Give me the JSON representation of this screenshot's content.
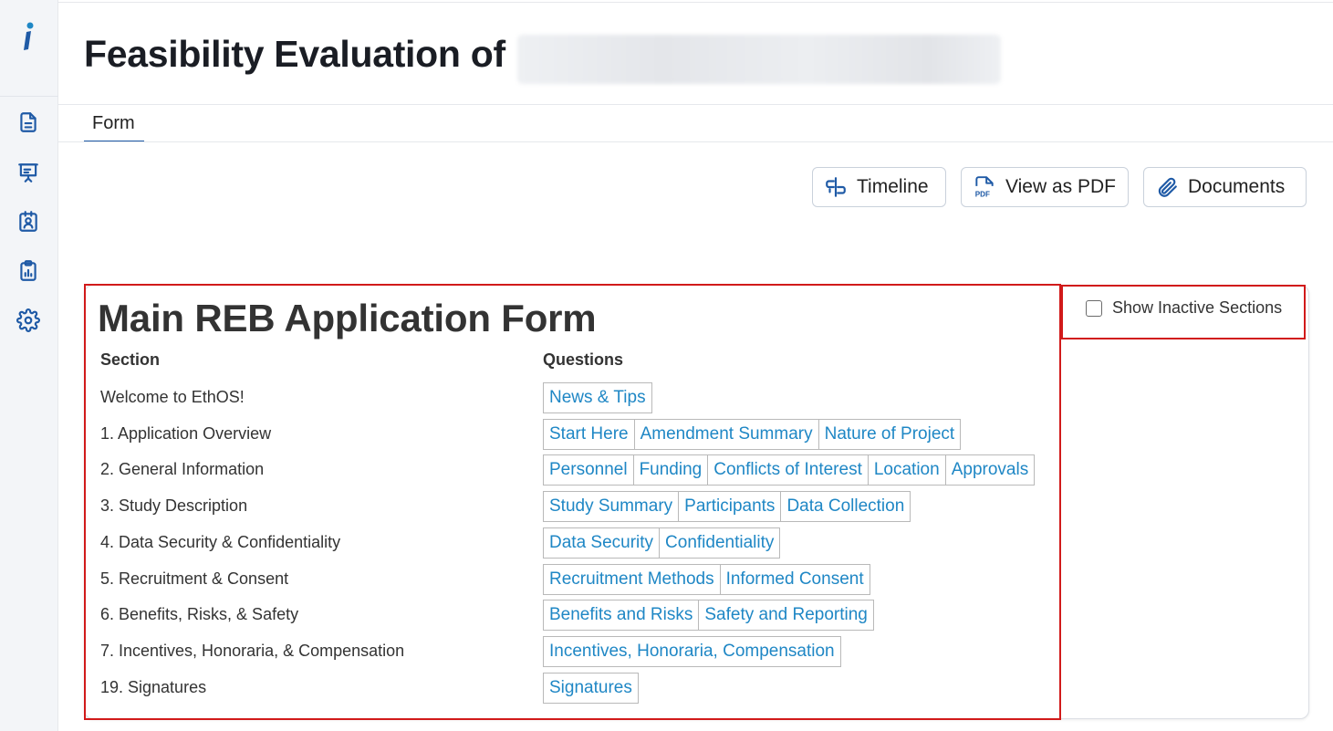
{
  "header": {
    "title": "Feasibility Evaluation of"
  },
  "tabs": [
    {
      "label": "Form",
      "active": true
    }
  ],
  "sidebar": {
    "icons": [
      "document-icon",
      "presentation-icon",
      "contact-card-icon",
      "clipboard-chart-icon",
      "gear-icon"
    ]
  },
  "actions": {
    "timeline": "Timeline",
    "pdf": "View as PDF",
    "documents": "Documents"
  },
  "form": {
    "title": "Main REB Application Form",
    "section_header": "Section",
    "questions_header": "Questions",
    "show_inactive_label": "Show Inactive Sections",
    "show_inactive_checked": false,
    "rows": [
      {
        "section": "Welcome to EthOS!",
        "questions": [
          "News & Tips"
        ]
      },
      {
        "section": "1. Application Overview",
        "questions": [
          "Start Here",
          "Amendment Summary",
          "Nature of Project"
        ]
      },
      {
        "section": "2. General Information",
        "questions": [
          "Personnel",
          "Funding",
          "Conflicts of Interest",
          "Location",
          "Approvals"
        ]
      },
      {
        "section": "3. Study Description",
        "questions": [
          "Study Summary",
          "Participants",
          "Data Collection"
        ]
      },
      {
        "section": "4. Data Security & Confidentiality",
        "questions": [
          "Data Security",
          "Confidentiality"
        ]
      },
      {
        "section": "5. Recruitment & Consent",
        "questions": [
          "Recruitment Methods",
          "Informed Consent"
        ]
      },
      {
        "section": "6. Benefits, Risks, & Safety",
        "questions": [
          "Benefits and Risks",
          "Safety and Reporting"
        ]
      },
      {
        "section": "7. Incentives, Honoraria, & Compensation",
        "questions": [
          "Incentives, Honoraria, Compensation"
        ]
      },
      {
        "section": "19. Signatures",
        "questions": [
          "Signatures"
        ]
      }
    ]
  },
  "colors": {
    "accent": "#1f5aa6",
    "link": "#1f87c5",
    "highlight": "#d11a1a"
  }
}
